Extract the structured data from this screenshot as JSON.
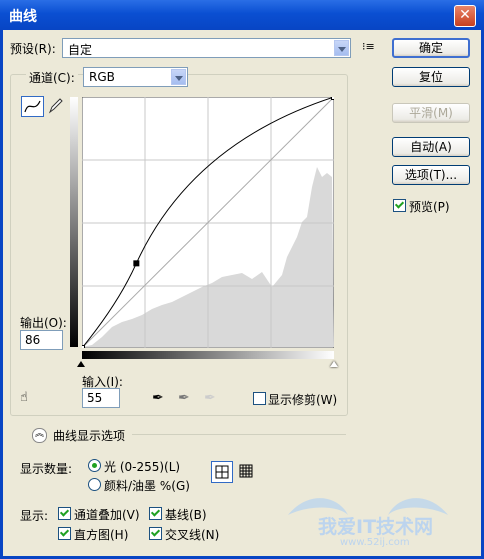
{
  "window": {
    "title": "曲线"
  },
  "preset": {
    "label": "预设(R):",
    "value": "自定"
  },
  "buttons": {
    "ok": "确定",
    "reset": "复位",
    "smooth": "平滑(M)",
    "auto": "自动(A)",
    "options": "选项(T)...",
    "preview": "预览(P)"
  },
  "channel": {
    "label": "通道(C):",
    "value": "RGB"
  },
  "output": {
    "label": "输出(O):",
    "value": "86"
  },
  "input": {
    "label": "输入(I):",
    "value": "55"
  },
  "show_clipping": "显示修剪(W)",
  "curve_display_options": "曲线显示选项",
  "show_amount": {
    "label": "显示数量:",
    "light": "光 (0-255)(L)",
    "pigment": "颜料/油墨 %(G)"
  },
  "show": {
    "label": "显示:",
    "channel_overlay": "通道叠加(V)",
    "baseline": "基线(B)",
    "histogram": "直方图(H)",
    "intersection": "交叉线(N)"
  },
  "watermark": {
    "name": "我爱IT技术网",
    "url": "www.52ij.com"
  },
  "curve": {
    "points": [
      [
        0,
        0
      ],
      [
        55,
        86
      ],
      [
        255,
        255
      ]
    ]
  },
  "colors": {
    "title_bar": "#0845c4",
    "dialog_bg": "#ece9d8"
  }
}
